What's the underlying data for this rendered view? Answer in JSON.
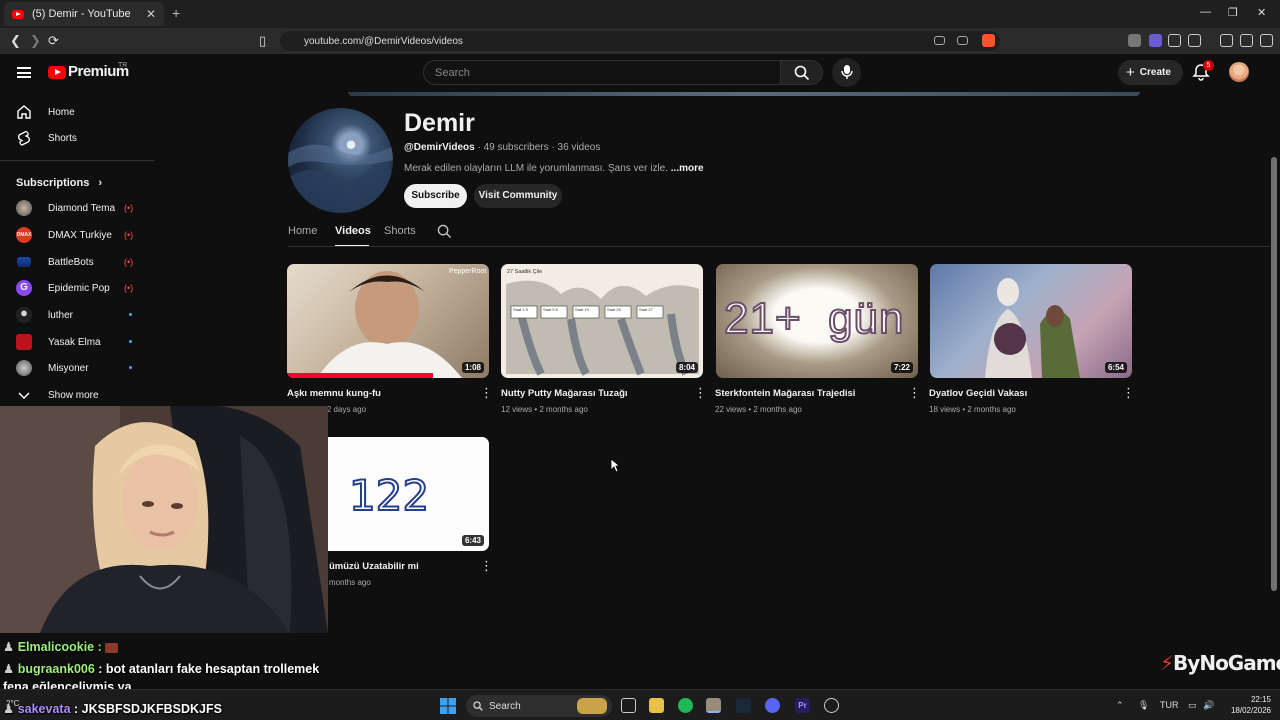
{
  "browser": {
    "tab_title": "(5) Demir - YouTube",
    "tab_close": "✕",
    "new_tab": "+",
    "url": "youtube.com/@DemirVideos/videos",
    "window_controls": [
      "—",
      "❐",
      "✕"
    ]
  },
  "header": {
    "brand": "Premium",
    "region": "TR",
    "search_placeholder": "Search",
    "create_label": "Create",
    "notifications_count": "5"
  },
  "sidebar": {
    "main_items": [
      {
        "label": "Home",
        "icon": "home-icon"
      },
      {
        "label": "Shorts",
        "icon": "shorts-icon"
      }
    ],
    "subscriptions_heading": "Subscriptions",
    "subscriptions_chevron": "›",
    "subscriptions": [
      {
        "name": "Diamond Tema",
        "status": "live"
      },
      {
        "name": "DMAX Turkiye",
        "status": "live"
      },
      {
        "name": "BattleBots",
        "status": "live"
      },
      {
        "name": "Epidemic Pop",
        "status": "live"
      },
      {
        "name": "luther",
        "status": "new"
      },
      {
        "name": "Yasak Elma",
        "status": "new"
      },
      {
        "name": "Misyoner",
        "status": "new"
      }
    ],
    "live_glyph": "(•)",
    "show_more": "Show more"
  },
  "channel": {
    "name": "Demir",
    "handle": "@DemirVideos",
    "subscribers": "· 49 subscribers · 36 videos",
    "description": "Merak edilen olayların LLM ile yorumlanması. Şans ver izle.",
    "more": "...more",
    "subscribe_label": "Subscribe",
    "community_label": "Visit Community",
    "tabs": [
      "Home",
      "Videos",
      "Shorts"
    ]
  },
  "videos": [
    {
      "title": "Aşkı memnu kung-fu",
      "meta": "· 2 days ago",
      "duration": "1:08"
    },
    {
      "title": "Nutty Putty Mağarası Tuzağı",
      "meta": "12 views • 2 months ago",
      "duration": "8:04"
    },
    {
      "title": "Sterkfontein Mağarası Trajedisi",
      "meta": "22 views • 2 months ago",
      "duration": "7:22"
    },
    {
      "title": "Dyatlov Geçidi Vakası",
      "meta": "18 views • 2 months ago",
      "duration": "6:54"
    },
    {
      "title": "ümüzü Uzatabilir mi",
      "meta": "months ago",
      "duration": "6:43"
    }
  ],
  "thumb_text": {
    "v2_heading": "27 Saatlik Çile",
    "v2_cells": [
      "Saat 1.5",
      "Saat 5.5",
      "Saat 10",
      "Saat 20",
      "Saat 27"
    ],
    "v1_watermark": "PepperRoot",
    "v3_text": "21+  gün",
    "v5_text": "122"
  },
  "chat": [
    {
      "user": "Elmalicookie :",
      "text": ""
    },
    {
      "user": "bugraank006",
      "text": " : bot atanları fake hesaptan trollemek"
    },
    {
      "user": "",
      "text": "fena eğlenceliymiş ya"
    },
    {
      "user": "sakevata",
      "text": " : JKSBFSDJKFBSDKJFS"
    }
  ],
  "watermark": "ByNoGame",
  "taskbar": {
    "search_label": "Search",
    "language": "TUR",
    "time": "22:15",
    "date": "18/02/2026",
    "weather": "2°C"
  },
  "colors": {
    "accent_red": "#ff0000",
    "live_red": "#ff4e45",
    "link_blue": "#3ea6ff",
    "chat_user_green": "#9cf078"
  }
}
